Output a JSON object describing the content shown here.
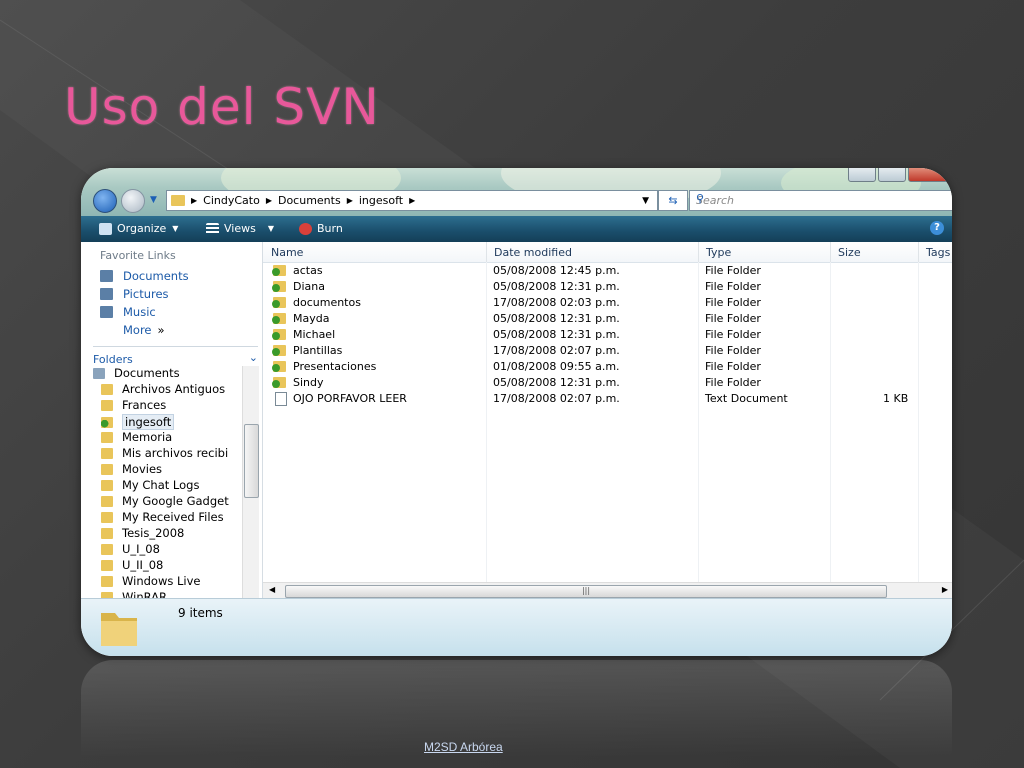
{
  "slide": {
    "title": "Uso del SVN",
    "footer_link": "M2SD Arbórea"
  },
  "explorer": {
    "breadcrumb": [
      "CindyCato",
      "Documents",
      "ingesoft"
    ],
    "search_placeholder": "Search",
    "toolbar": {
      "organize": "Organize",
      "views": "Views",
      "burn": "Burn"
    },
    "favorite_links_header": "Favorite Links",
    "favorite_links": [
      "Documents",
      "Pictures",
      "Music",
      "More"
    ],
    "folders_header": "Folders",
    "tree": [
      "Documents",
      "Archivos Antiguos",
      "Frances",
      "ingesoft",
      "Memoria",
      "Mis archivos recibi",
      "Movies",
      "My Chat Logs",
      "My Google Gadget",
      "My Received Files",
      "Tesis_2008",
      "U_I_08",
      "U_II_08",
      "Windows Live",
      "WinRAR"
    ],
    "selected_tree_item": "ingesoft",
    "columns": [
      "Name",
      "Date modified",
      "Type",
      "Size",
      "Tags"
    ],
    "files": [
      {
        "name": "actas",
        "date": "05/08/2008 12:45 p.m.",
        "type": "File Folder",
        "size": ""
      },
      {
        "name": "Diana",
        "date": "05/08/2008 12:31 p.m.",
        "type": "File Folder",
        "size": ""
      },
      {
        "name": "documentos",
        "date": "17/08/2008 02:03 p.m.",
        "type": "File Folder",
        "size": ""
      },
      {
        "name": "Mayda",
        "date": "05/08/2008 12:31 p.m.",
        "type": "File Folder",
        "size": ""
      },
      {
        "name": "Michael",
        "date": "05/08/2008 12:31 p.m.",
        "type": "File Folder",
        "size": ""
      },
      {
        "name": "Plantillas",
        "date": "17/08/2008 02:07 p.m.",
        "type": "File Folder",
        "size": ""
      },
      {
        "name": "Presentaciones",
        "date": "01/08/2008 09:55 a.m.",
        "type": "File Folder",
        "size": ""
      },
      {
        "name": "Sindy",
        "date": "05/08/2008 12:31 p.m.",
        "type": "File Folder",
        "size": ""
      },
      {
        "name": "OJO PORFAVOR LEER",
        "date": "17/08/2008 02:07 p.m.",
        "type": "Text Document",
        "size": "1 KB"
      }
    ],
    "details": {
      "item_count": "9 items"
    },
    "colors": {
      "accent_title": "#e8589a",
      "toolbar": "#1a4e6b",
      "link": "#1c5aa8"
    }
  }
}
